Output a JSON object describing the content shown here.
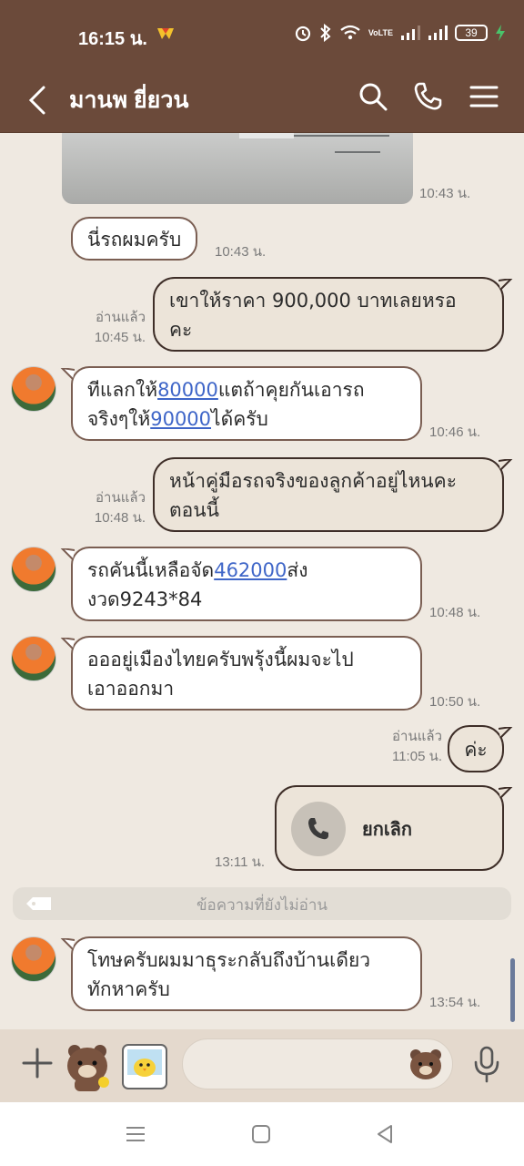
{
  "status_bar": {
    "time": "16:15 น.",
    "battery": "39",
    "network": "VoLTE"
  },
  "header": {
    "title": "มานพ  ยี่ยวน"
  },
  "messages": [
    {
      "type": "image",
      "time": "10:43 น."
    },
    {
      "type": "in",
      "text": "นี่รถผมครับ",
      "time": "10:43 น."
    },
    {
      "type": "out",
      "read": "อ่านแล้ว",
      "text_line1": "เขาให้ราคา 900,000 บาทเลยหรอ",
      "text_line2": "คะ",
      "time": "10:45 น."
    },
    {
      "type": "in",
      "seg1": "ทีแลกให้",
      "link1": "80000",
      "seg2": "แตถ้าคุยกันเอารถ",
      "seg3": "จริงๆให้",
      "link2": "90000",
      "seg4": "ได้ครับ",
      "time": "10:46 น."
    },
    {
      "type": "out",
      "read": "อ่านแล้ว",
      "text_line1": "หน้าคู่มือรถจริงของลูกค้าอยู่ไหนคะ",
      "text_line2": "ตอนนี้",
      "time": "10:48 น."
    },
    {
      "type": "in",
      "seg1": "รถคันนี้เหลือจัด",
      "link1": "462000",
      "seg2": "ส่ง",
      "line2": "งวด9243*84",
      "time": "10:48 น."
    },
    {
      "type": "in",
      "text_line1": "อออยู่เมืองไทยครับพรุ้งนี้ผมจะไป",
      "text_line2": "เอาออกมา",
      "time": "10:50 น."
    },
    {
      "type": "out",
      "read": "อ่านแล้ว",
      "text": "ค่ะ",
      "time": "11:05 น."
    },
    {
      "type": "call",
      "label": "ยกเลิก",
      "time": "13:11 น."
    },
    {
      "type": "divider",
      "text": "ข้อความที่ยังไม่อ่าน"
    },
    {
      "type": "in",
      "text_line1": "โทษครับผมมาธุระกลับถึงบ้านเดียว",
      "text_line2": "ทักหาครับ",
      "time": "13:54 น."
    }
  ],
  "colors": {
    "header_bg": "#6b4a3a",
    "chat_bg": "#efe9e1",
    "link": "#3f66c8",
    "input_bar": "#e4d9cd"
  },
  "icons": [
    "back-icon",
    "search-icon",
    "phone-icon",
    "menu-icon",
    "plus-icon",
    "sticker-icon",
    "mic-icon",
    "emoji-icon"
  ]
}
